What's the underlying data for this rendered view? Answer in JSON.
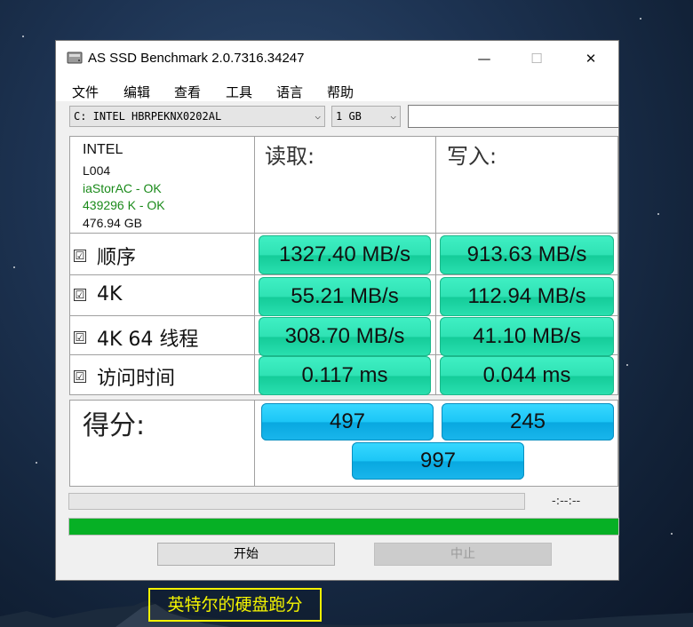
{
  "window": {
    "title": "AS SSD Benchmark 2.0.7316.34247",
    "minimize_glyph": "—",
    "maximize_glyph": "☐",
    "close_glyph": "✕"
  },
  "menu": [
    "文件",
    "编辑",
    "查看",
    "工具",
    "语言",
    "帮助"
  ],
  "toolbar": {
    "drive_select": "C: INTEL HBRPEKNX0202AL",
    "size_select": "1 GB",
    "text_field": ""
  },
  "drive_info": {
    "vendor": "INTEL",
    "firmware": "L004",
    "driver_status": "iaStorAC - OK",
    "alignment_status": "439296 K - OK",
    "capacity": "476.94 GB",
    "ok_color": "#1a8a1a"
  },
  "columns": {
    "read": "读取:",
    "write": "写入:"
  },
  "rows": [
    {
      "checkbox": "☑",
      "label": "顺序",
      "read": "1327.40 MB/s",
      "write": "913.63 MB/s"
    },
    {
      "checkbox": "☑",
      "label": "4K",
      "read": "55.21 MB/s",
      "write": "112.94 MB/s"
    },
    {
      "checkbox": "☑",
      "label": "4K 64 线程",
      "read": "308.70 MB/s",
      "write": "41.10 MB/s"
    },
    {
      "checkbox": "☑",
      "label": "访问时间",
      "read": "0.117 ms",
      "write": "0.044 ms"
    }
  ],
  "score": {
    "label": "得分:",
    "read": "497",
    "write": "245",
    "total": "997"
  },
  "progress": {
    "time": "-:--:--",
    "fraction": 1.0,
    "color": "#06b025"
  },
  "buttons": {
    "start": "开始",
    "abort": "中止"
  },
  "caption": "英特尔的硬盘跑分"
}
